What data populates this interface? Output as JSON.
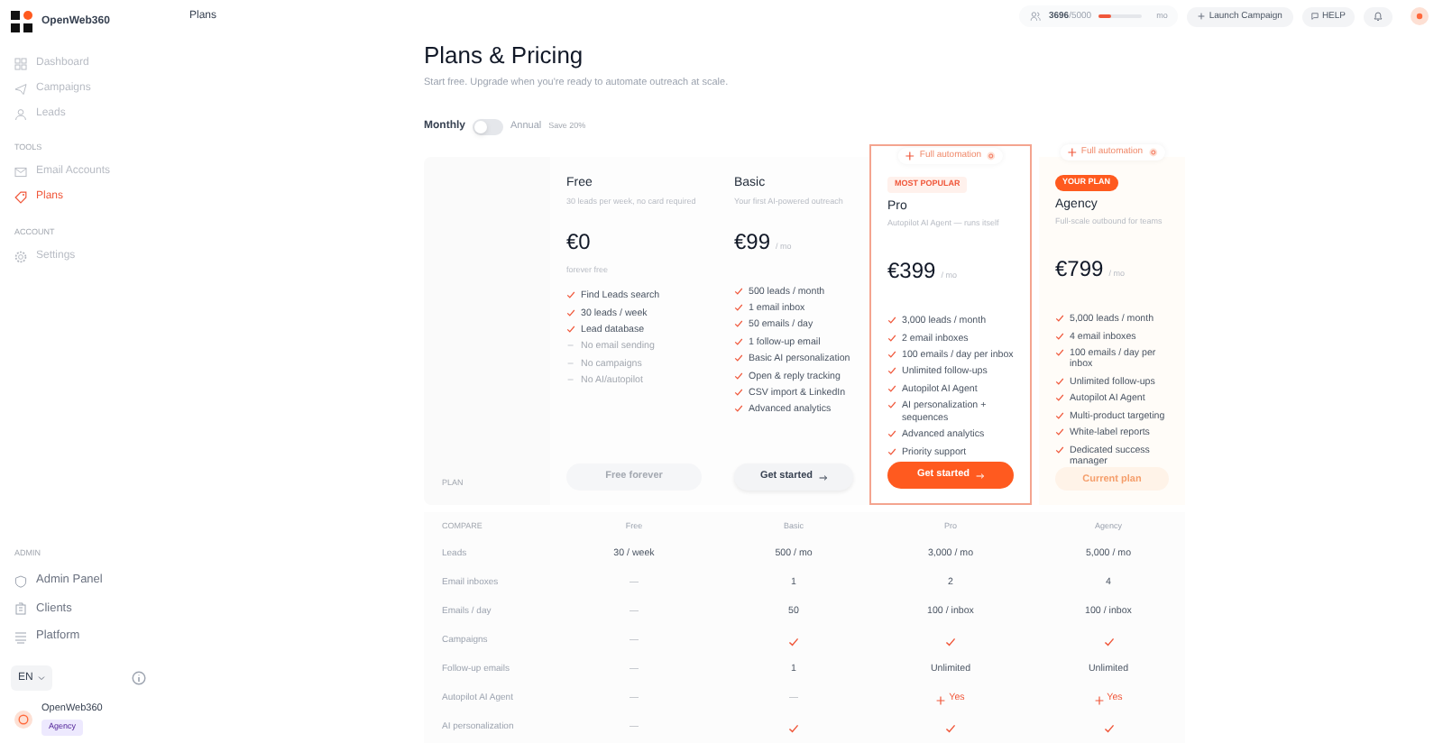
{
  "brand": {
    "name": "OpenWeb360"
  },
  "header": {
    "title": "Plans"
  },
  "sidebar": {
    "sections": [
      {
        "items": [
          {
            "label": "Dashboard",
            "selected": false
          },
          {
            "label": "Campaigns",
            "selected": false
          },
          {
            "label": "Leads",
            "selected": false
          }
        ]
      },
      {
        "heading": "TOOLS",
        "items": [
          {
            "label": "Email Accounts",
            "selected": false
          },
          {
            "label": "Plans",
            "selected": true
          }
        ]
      },
      {
        "heading": "ACCOUNT",
        "items": [
          {
            "label": "Settings",
            "selected": false
          }
        ]
      }
    ],
    "admin": {
      "heading": "ADMIN",
      "items": [
        {
          "label": "Admin Panel"
        },
        {
          "label": "Clients"
        },
        {
          "label": "Platform"
        }
      ]
    },
    "language": "EN",
    "user": {
      "name": "OpenWeb360",
      "badge": "Agency"
    }
  },
  "topbar": {
    "usage": {
      "used": "3696",
      "total": "/5000",
      "level": 0.3,
      "period": "mo"
    },
    "launch_button": "Launch Campaign",
    "help_button": "HELP"
  },
  "page": {
    "title": "Plans & Pricing",
    "subtitle": "Start free. Upgrade when you're ready to automate outreach at scale.",
    "billing": {
      "monthly": "Monthly",
      "annual": "Annual",
      "save": "Save 20%",
      "annual_on": false
    }
  },
  "plans_label": "PLAN",
  "plans": [
    {
      "name": "Free",
      "description": "30 leads per week, no card required",
      "price": "€0",
      "note": "forever free",
      "highlighted": false,
      "button": {
        "label": "Free forever",
        "kind": "disabled"
      },
      "features": [
        {
          "text": "Find Leads search",
          "included": true
        },
        {
          "text": "30 leads / week",
          "included": true
        },
        {
          "text": "Lead database",
          "included": true
        },
        {
          "text": "No email sending",
          "included": false
        },
        {
          "text": "No campaigns",
          "included": false
        },
        {
          "text": "No AI/autopilot",
          "included": false
        }
      ]
    },
    {
      "name": "Basic",
      "description": "Your first AI-powered outreach",
      "price": "€99",
      "period": "/ mo",
      "highlighted": false,
      "button": {
        "label": "Get started",
        "kind": "secondary"
      },
      "features": [
        {
          "text": "500 leads / month",
          "included": true
        },
        {
          "text": "1 email inbox",
          "included": true
        },
        {
          "text": "50 emails / day",
          "included": true
        },
        {
          "text": "1 follow-up email",
          "included": true
        },
        {
          "text": "Basic AI personalization",
          "included": true
        },
        {
          "text": "Open & reply tracking",
          "included": true
        },
        {
          "text": "CSV import & LinkedIn",
          "included": true
        },
        {
          "text": "Advanced analytics",
          "included": true
        }
      ]
    },
    {
      "name": "Pro",
      "tag": "Full automation",
      "badge": "MOST POPULAR",
      "description": "Autopilot AI Agent — runs itself",
      "price": "€399",
      "period": "/ mo",
      "highlighted": true,
      "button": {
        "label": "Get started",
        "kind": "primary"
      },
      "features": [
        {
          "text": "3,000 leads / month",
          "included": true
        },
        {
          "text": "2 email inboxes",
          "included": true
        },
        {
          "text": "100 emails / day per inbox",
          "included": true
        },
        {
          "text": "Unlimited follow-ups",
          "included": true
        },
        {
          "text": "Autopilot AI Agent",
          "included": true
        },
        {
          "text": "AI personalization + sequences",
          "included": true
        },
        {
          "text": "Advanced analytics",
          "included": true
        },
        {
          "text": "Priority support",
          "included": true
        }
      ]
    },
    {
      "name": "Agency",
      "tag": "Full automation",
      "badge": "YOUR PLAN",
      "description": "Full-scale outbound for teams",
      "price": "€799",
      "period": "/ mo",
      "highlighted": false,
      "current": true,
      "button": {
        "label": "Current plan",
        "kind": "current"
      },
      "features": [
        {
          "text": "5,000 leads / month",
          "included": true
        },
        {
          "text": "4 email inboxes",
          "included": true
        },
        {
          "text": "100 emails / day per inbox",
          "included": true
        },
        {
          "text": "Unlimited follow-ups",
          "included": true
        },
        {
          "text": "Autopilot AI Agent",
          "included": true
        },
        {
          "text": "Multi-product targeting",
          "included": true
        },
        {
          "text": "White-label reports",
          "included": true
        },
        {
          "text": "Dedicated success manager",
          "included": true
        }
      ]
    }
  ],
  "compare": {
    "columns": [
      "COMPARE",
      "Free",
      "Basic",
      "Pro",
      "Agency"
    ],
    "rows": [
      {
        "cells": [
          {
            "kind": "label",
            "text": "Leads"
          },
          {
            "kind": "text",
            "text": "30 / week"
          },
          {
            "kind": "text",
            "text": "500 / mo"
          },
          {
            "kind": "text",
            "text": "3,000 / mo"
          },
          {
            "kind": "text",
            "text": "5,000 / mo"
          }
        ]
      },
      {
        "cells": [
          {
            "kind": "label",
            "text": "Email inboxes"
          },
          {
            "kind": "dash",
            "text": "—"
          },
          {
            "kind": "text",
            "text": "1"
          },
          {
            "kind": "text",
            "text": "2"
          },
          {
            "kind": "text",
            "text": "4"
          }
        ]
      },
      {
        "cells": [
          {
            "kind": "label",
            "text": "Emails / day"
          },
          {
            "kind": "dash",
            "text": "—"
          },
          {
            "kind": "text",
            "text": "50"
          },
          {
            "kind": "text",
            "text": "100 / inbox"
          },
          {
            "kind": "text",
            "text": "100 / inbox"
          }
        ]
      },
      {
        "cells": [
          {
            "kind": "label",
            "text": "Campaigns"
          },
          {
            "kind": "dash",
            "text": "—"
          },
          {
            "kind": "check"
          },
          {
            "kind": "check"
          },
          {
            "kind": "check"
          }
        ]
      },
      {
        "cells": [
          {
            "kind": "label",
            "text": "Follow-up emails"
          },
          {
            "kind": "dash",
            "text": "—"
          },
          {
            "kind": "text",
            "text": "1"
          },
          {
            "kind": "text",
            "text": "Unlimited"
          },
          {
            "kind": "text",
            "text": "Unlimited"
          }
        ]
      },
      {
        "cells": [
          {
            "kind": "label",
            "text": "Autopilot AI Agent"
          },
          {
            "kind": "dash",
            "text": "—"
          },
          {
            "kind": "dash",
            "text": "—"
          },
          {
            "kind": "yes",
            "text": "Yes"
          },
          {
            "kind": "yes",
            "text": "Yes"
          }
        ]
      },
      {
        "cells": [
          {
            "kind": "label",
            "text": "AI personalization"
          },
          {
            "kind": "dash",
            "text": "—"
          },
          {
            "kind": "check"
          },
          {
            "kind": "check"
          },
          {
            "kind": "check"
          }
        ]
      }
    ]
  }
}
